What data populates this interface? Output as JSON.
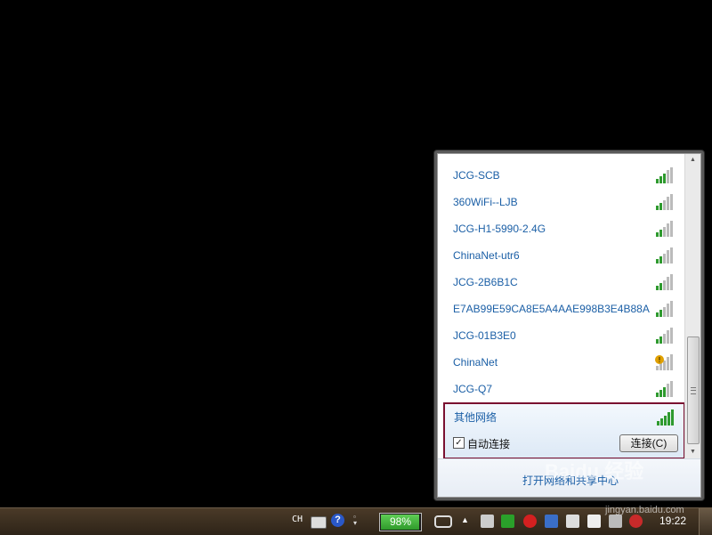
{
  "wifi_popup": {
    "networks": [
      {
        "name": "JCG-SCB",
        "signal": "full",
        "secured": false
      },
      {
        "name": "360WiFi--LJB",
        "signal": "full",
        "secured": false
      },
      {
        "name": "JCG-H1-5990-2.4G",
        "signal": "full",
        "secured": false
      },
      {
        "name": "ChinaNet-utr6",
        "signal": "full",
        "secured": false
      },
      {
        "name": "JCG-2B6B1C",
        "signal": "full",
        "secured": false
      },
      {
        "name": "E7AB99E59CA8E5A4AAE998B3E4B88A",
        "signal": "full",
        "secured": false
      },
      {
        "name": "JCG-01B3E0",
        "signal": "full",
        "secured": false
      },
      {
        "name": "ChinaNet",
        "signal": "full",
        "secured": true
      },
      {
        "name": "JCG-Q7",
        "signal": "full",
        "secured": false
      }
    ],
    "other_network": {
      "name": "其他网络",
      "auto_connect_label": "自动连接",
      "auto_connect_checked": true,
      "connect_button": "连接(C)"
    },
    "footer_link": "打开网络和共享中心"
  },
  "taskbar": {
    "language": "CH",
    "battery_percent": "98%",
    "battery_level": 0.98,
    "clock": "19:22"
  },
  "watermark": {
    "brand": "Baidu 经验",
    "url": "jingyan.baidu.com"
  },
  "colors": {
    "link": "#1b5fa6",
    "highlight_border": "#7a1030",
    "signal_green": "#2e9a2e"
  }
}
